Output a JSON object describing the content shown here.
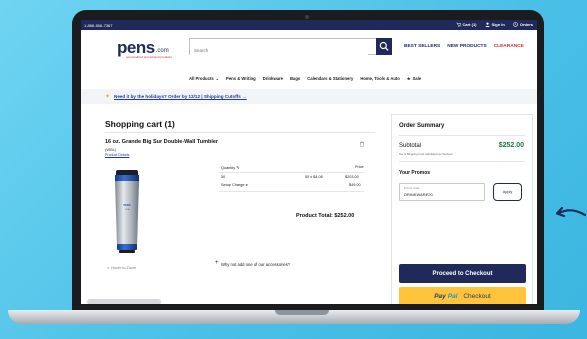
{
  "util": {
    "phone": "1-866-506-7367",
    "cart": "Cart (1)",
    "signin": "Sign In",
    "orders": "Orders"
  },
  "logo": {
    "word": "pens",
    "com": ".com",
    "tagline": "personalized promotional products"
  },
  "search": {
    "placeholder": "Search"
  },
  "header_nav": [
    "BEST SELLERS",
    "NEW PRODUCTS",
    "CLEARANCE"
  ],
  "categories": [
    "All Products",
    "Pens & Writing",
    "Drinkware",
    "Bags",
    "Calendars & Stationery",
    "Home, Tools & Auto",
    "Sale"
  ],
  "promo_banner": "Need it by the holidays? Order by 12/12 | Shipping Cutoffs",
  "cart": {
    "title": "Shopping cart (1)",
    "product_name": "16 oz. Grande Big Sur Double-Wall Tumbler",
    "sku": "(WBL)",
    "details_link": "Product Details",
    "zoom_label": "Hover to Zoom",
    "quantity_label": "Quantity",
    "price_label": "Price",
    "quantity": "50",
    "unit_calc": "50 x $4.06",
    "line_price": "$203.00",
    "setup_label": "Setup Charge",
    "setup_price": "$49.00",
    "total_label": "Product Total:",
    "total_value": "$252.00",
    "accessories": "Why not add one of our accessories?"
  },
  "summary": {
    "title": "Order Summary",
    "subtotal_label": "Subtotal",
    "subtotal_value": "$252.00",
    "tax_note": "Tax & Shipping Cost calculated at checkout",
    "promos_title": "Your Promos",
    "promo_code_label": "Promo Code",
    "promo_code_value": "DRINKWARE20",
    "apply_label": "Apply",
    "checkout_label": "Proceed to Checkout",
    "paypal_a": "Pay",
    "paypal_b": "Pal",
    "paypal_c": "Checkout"
  },
  "colors": {
    "brand_navy": "#1f2a5a",
    "clearance_red": "#d32f2f",
    "subtotal_green": "#1a7a3c",
    "paypal_yellow": "#ffc439",
    "background": "#52c3e8"
  }
}
